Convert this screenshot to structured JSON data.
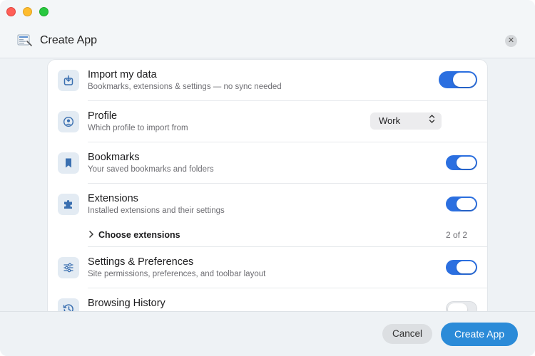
{
  "window": {
    "title": "Create App"
  },
  "settings": {
    "import_data": {
      "title": "Import my data",
      "subtitle": "Bookmarks, extensions & settings — no sync needed",
      "enabled": true
    },
    "profile": {
      "title": "Profile",
      "subtitle": "Which profile to import from",
      "selected": "Work"
    },
    "bookmarks": {
      "title": "Bookmarks",
      "subtitle": "Your saved bookmarks and folders",
      "enabled": true
    },
    "extensions": {
      "title": "Extensions",
      "subtitle": "Installed extensions and their settings",
      "enabled": true,
      "choose_label": "Choose extensions",
      "count": "2 of 2"
    },
    "preferences": {
      "title": "Settings & Preferences",
      "subtitle": "Site permissions, preferences, and toolbar layout",
      "enabled": true
    },
    "history": {
      "title": "Browsing History",
      "enabled": false
    }
  },
  "footer": {
    "cancel_label": "Cancel",
    "create_label": "Create App"
  },
  "colors": {
    "accent": "#2b6fe0",
    "primary_button": "#2b8bd8",
    "icon_tint": "#3a6fb0"
  }
}
